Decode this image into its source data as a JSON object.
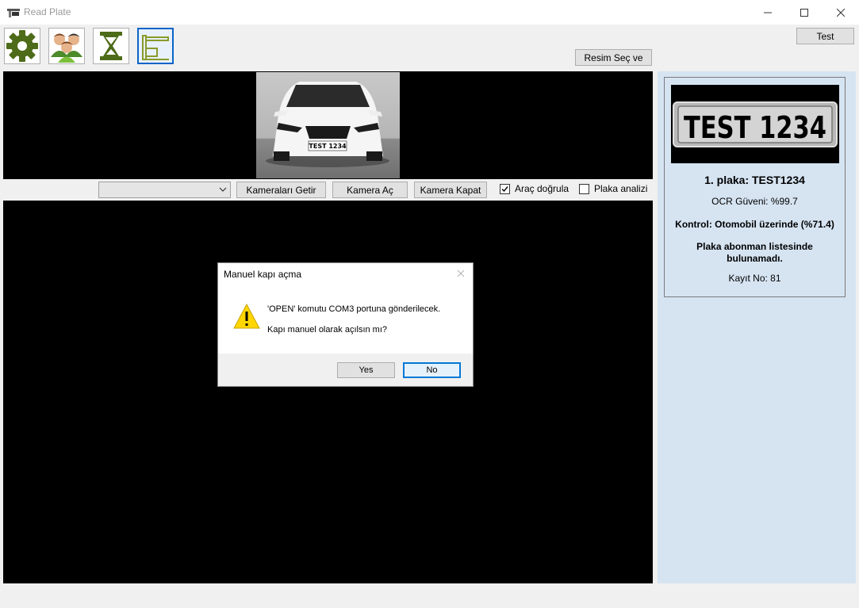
{
  "window": {
    "title": "Read Plate"
  },
  "toolbar": {
    "items": [
      {
        "icon": "gear-icon",
        "color": "#4e6b19"
      },
      {
        "icon": "users-icon",
        "color": "#8a4b2a"
      },
      {
        "icon": "hourglass-icon",
        "color": "#4e6b19"
      },
      {
        "icon": "barrier-gate-icon",
        "color": "#7a8f2a"
      }
    ],
    "test_label": "Test",
    "resim_sec_label": "Resim Seç ve"
  },
  "camera_controls": {
    "select_value": "",
    "kameralari_getir": "Kameraları Getir",
    "kamera_ac": "Kamera Aç",
    "kamera_kapat": "Kamera Kapat",
    "arac_dogrula": {
      "label": "Araç doğrula",
      "checked": true
    },
    "plaka_analizi": {
      "label": "Plaka analizi",
      "checked": false
    }
  },
  "photo": {
    "plate_text": "TEST 1234"
  },
  "result": {
    "plate_image_text": "TEST 1234",
    "plate_heading": "1. plaka: TEST1234",
    "ocr": "OCR Güveni: %99.7",
    "kontrol": "Kontrol: Otomobil üzerinde (%71.4)",
    "abonman_line1": "Plaka abonman listesinde",
    "abonman_line2": "bulunamadı.",
    "kayit": "Kayıt No: 81"
  },
  "dialog": {
    "title": "Manuel kapı açma",
    "message1": "'OPEN' komutu COM3 portuna gönderilecek.",
    "message2": "Kapı manuel olarak açılsın mı?",
    "yes": "Yes",
    "no": "No"
  },
  "colors": {
    "accent": "#0078d7",
    "panel": "#d6e4f2",
    "warning": "#ffd600"
  }
}
